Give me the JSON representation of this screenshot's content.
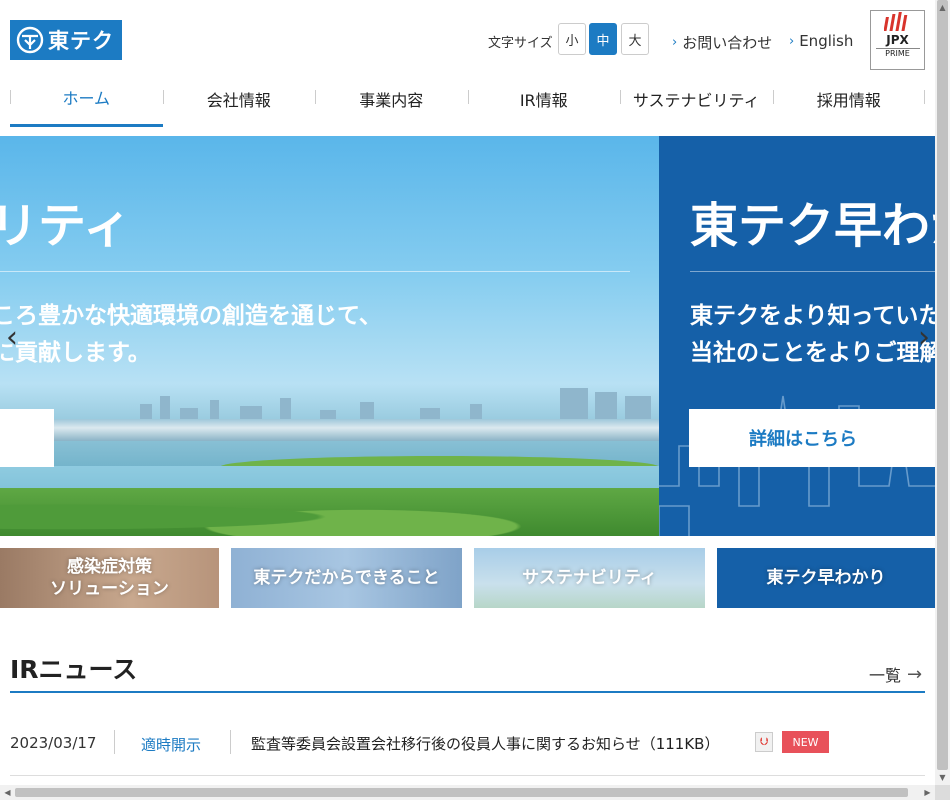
{
  "header": {
    "logo_text": "東テク",
    "font_size_label": "文字サイズ",
    "font_sizes": [
      "小",
      "中",
      "大"
    ],
    "contact_link": "お問い合わせ",
    "english_link": "English",
    "jpx_text": "JPX",
    "jpx_sub": "PRIME"
  },
  "nav": {
    "items": [
      "ホーム",
      "会社情報",
      "事業内容",
      "IR情報",
      "サステナビリティ",
      "採用情報"
    ]
  },
  "hero": {
    "left": {
      "title": "リティ",
      "text_line1": "ころ豊かな快適環境の創造を通じて、",
      "text_line2": "に貢献します。"
    },
    "right": {
      "title": "東テク早わか",
      "text_line1": "東テクをより知っていた",
      "text_line2": "当社のことをよりご理解",
      "button": "詳細はこちら"
    },
    "prev_arrow": "‹",
    "next_arrow": "›"
  },
  "banners": [
    "感染症対策\nソリューション",
    "東テクだからできること",
    "サステナビリティ",
    "東テク早わかり"
  ],
  "ir_news": {
    "title": "IRニュース",
    "more_label": "一覧",
    "items": [
      {
        "date": "2023/03/17",
        "category": "適時開示",
        "title": "監査等委員会設置会社移行後の役員人事に関するお知らせ（111KB）",
        "badge": "NEW"
      }
    ]
  },
  "colors": {
    "brand_blue": "#1c7bc3",
    "hero_dark_blue": "#1560a8",
    "new_badge": "#e8515a"
  }
}
